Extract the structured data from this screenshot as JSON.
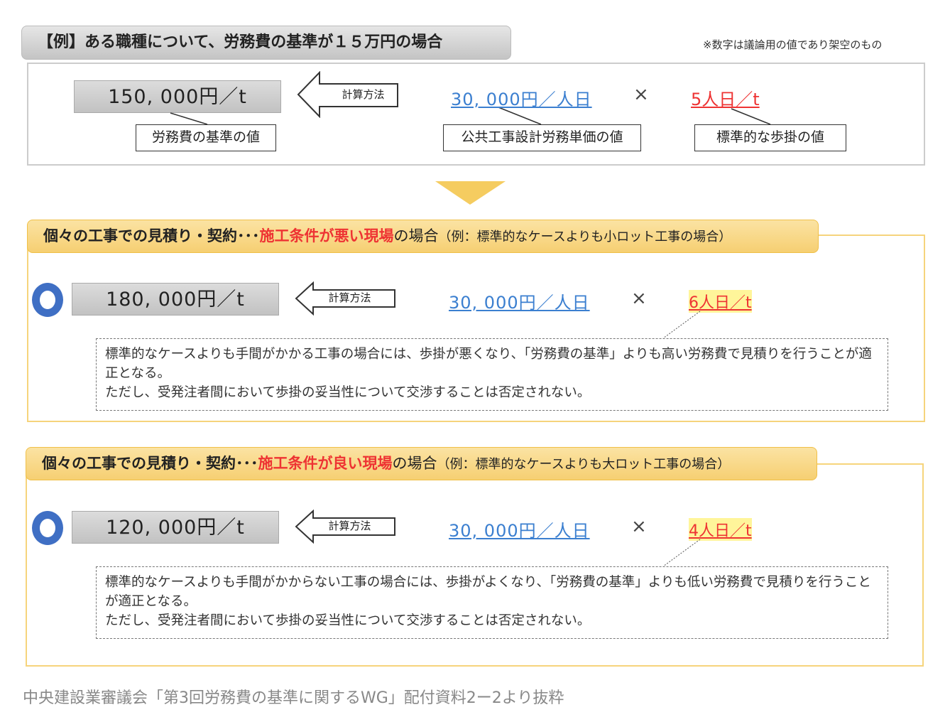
{
  "title": "【例】ある職種について、労務費の基準が１５万円の場合",
  "note": "※数字は議論用の値であり架空のもの",
  "example": {
    "value": "150, 000円／t",
    "value_label": "労務費の基準の値",
    "method": "計算方法",
    "unit_price": "30, 000円／人日",
    "unit_price_label": "公共工事設計労務単価の値",
    "times": "×",
    "productivity": "5人日／t",
    "productivity_label": "標準的な歩掛の値"
  },
  "sections": [
    {
      "header_prefix": "個々の工事での見積り・契約･･･",
      "header_highlight": "施工条件が悪い現場",
      "header_suffix": "の場合",
      "header_example": "（例：標準的なケースよりも小ロット工事の場合）",
      "value": "180, 000円／t",
      "method": "計算方法",
      "unit_price": "30, 000円／人日",
      "times": "×",
      "productivity": "6人日／t",
      "desc": [
        "標準的なケースよりも手間がかかる工事の場合には、歩掛が悪くなり、「労務費の基準」よりも高い労務費で見積りを行うことが適正となる。",
        "ただし、受発注者間において歩掛の妥当性について交渉することは否定されない。"
      ]
    },
    {
      "header_prefix": "個々の工事での見積り・契約･･･",
      "header_highlight": "施工条件が良い現場",
      "header_suffix": "の場合",
      "header_example": "（例：標準的なケースよりも大ロット工事の場合）",
      "value": "120, 000円／t",
      "method": "計算方法",
      "unit_price": "30, 000円／人日",
      "times": "×",
      "productivity": "4人日／t",
      "desc": [
        "標準的なケースよりも手間がかからない工事の場合には、歩掛がよくなり、「労務費の基準」よりも低い労務費で見積りを行うことが適正となる。",
        "ただし、受発注者間において歩掛の妥当性について交渉することは否定されない。"
      ]
    }
  ],
  "footer": "中央建設業審議会「第3回労務費の基準に関するWG」配付資料2ー2より抜粋"
}
